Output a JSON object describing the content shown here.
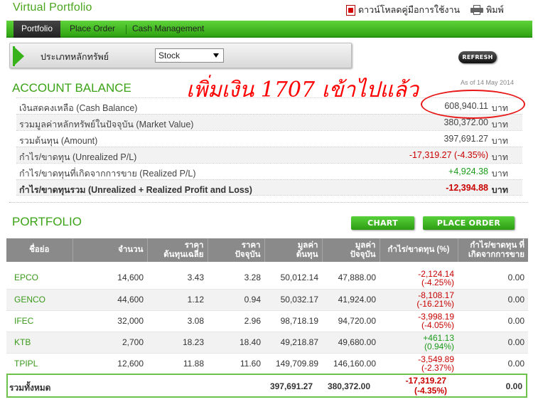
{
  "header": {
    "title": "Virtual Portfolio",
    "download_label": "ดาวน์โหลดคู่มือการใช้งาน",
    "print_label": "พิมพ์"
  },
  "nav": {
    "tabs": [
      {
        "label": "Portfolio",
        "active": true
      },
      {
        "label": "Place Order",
        "active": false
      },
      {
        "label": "Cash Management",
        "active": false
      }
    ]
  },
  "filter": {
    "label": "ประเภทหลักทรัพย์",
    "selected": "Stock"
  },
  "refresh_label": "REFRESH",
  "annotation": "เพิ่มเงิน 1707 เข้าไปแล้ว",
  "account_balance": {
    "title": "ACCOUNT BALANCE",
    "as_of": "As of 14 May 2014",
    "rows": [
      {
        "label": "เงินสดคงเหลือ (Cash Balance)",
        "value": "608,940.11",
        "unit": "บาท"
      },
      {
        "label": "รวมมูลค่าหลักทรัพย์ในปัจจุบัน (Market Value)",
        "value": "380,372.00",
        "unit": "บาท"
      },
      {
        "label": "รวมต้นทุน (Amount)",
        "value": "397,691.27",
        "unit": "บาท"
      },
      {
        "label": "กำไร/ขาดทุน (Unrealized P/L)",
        "value": "-17,319.27 (-4.35%)",
        "unit": "บาท"
      },
      {
        "label": "กำไร/ขาดทุนที่เกิดจากการขาย (Realized P/L)",
        "value": "+4,924.38",
        "unit": "บาท"
      },
      {
        "label": "กำไร/ขาดทุนรวม (Unrealized + Realized Profit and Loss)",
        "value": "-12,394.88",
        "unit": "บาท"
      }
    ]
  },
  "portfolio": {
    "title": "PORTFOLIO",
    "chart_label": "CHART",
    "place_order_label": "PLACE ORDER",
    "columns": [
      "ชื่อย่อ",
      "จำนวน",
      "ราคา\nต้นทุนเฉลี่ย",
      "ราคา\nปัจจุบัน",
      "มูลค่า\nต้นทุน",
      "มูลค่า\nปัจจุบัน",
      "กำไร/ขาดทุน (%)",
      "กำไร/ขาดทุน ที่\nเกิดจากการขาย"
    ],
    "rows": [
      {
        "symbol": "EPCO",
        "qty": "14,600",
        "avg_cost": "3.43",
        "price": "3.28",
        "cost_value": "50,012.14",
        "market_value": "47,888.00",
        "pl": "-2,124.14",
        "pl_pct": "(-4.25%)",
        "realized": "0.00"
      },
      {
        "symbol": "GENCO",
        "qty": "44,600",
        "avg_cost": "1.12",
        "price": "0.94",
        "cost_value": "50,032.17",
        "market_value": "41,924.00",
        "pl": "-8,108.17",
        "pl_pct": "(-16.21%)",
        "realized": "0.00"
      },
      {
        "symbol": "IFEC",
        "qty": "32,000",
        "avg_cost": "3.08",
        "price": "2.96",
        "cost_value": "98,718.19",
        "market_value": "94,720.00",
        "pl": "-3,998.19",
        "pl_pct": "(-4.05%)",
        "realized": "0.00"
      },
      {
        "symbol": "KTB",
        "qty": "2,700",
        "avg_cost": "18.23",
        "price": "18.40",
        "cost_value": "49,218.87",
        "market_value": "49,680.00",
        "pl": "+461.13",
        "pl_pct": "(0.94%)",
        "realized": "0.00"
      },
      {
        "symbol": "TPIPL",
        "qty": "12,600",
        "avg_cost": "11.88",
        "price": "11.60",
        "cost_value": "149,709.89",
        "market_value": "146,160.00",
        "pl": "-3,549.89",
        "pl_pct": "(-2.37%)",
        "realized": "0.00"
      }
    ],
    "total": {
      "label": "รวมทั้งหมด",
      "cost_value": "397,691.27",
      "market_value": "380,372.00",
      "pl": "-17,319.27",
      "pl_pct": "(-4.35%)",
      "realized": "0.00"
    }
  },
  "colors": {
    "brand_green": "#3aa315",
    "negative": "#c80000",
    "positive": "#1a9a1a",
    "annotation": "#ff0000"
  }
}
